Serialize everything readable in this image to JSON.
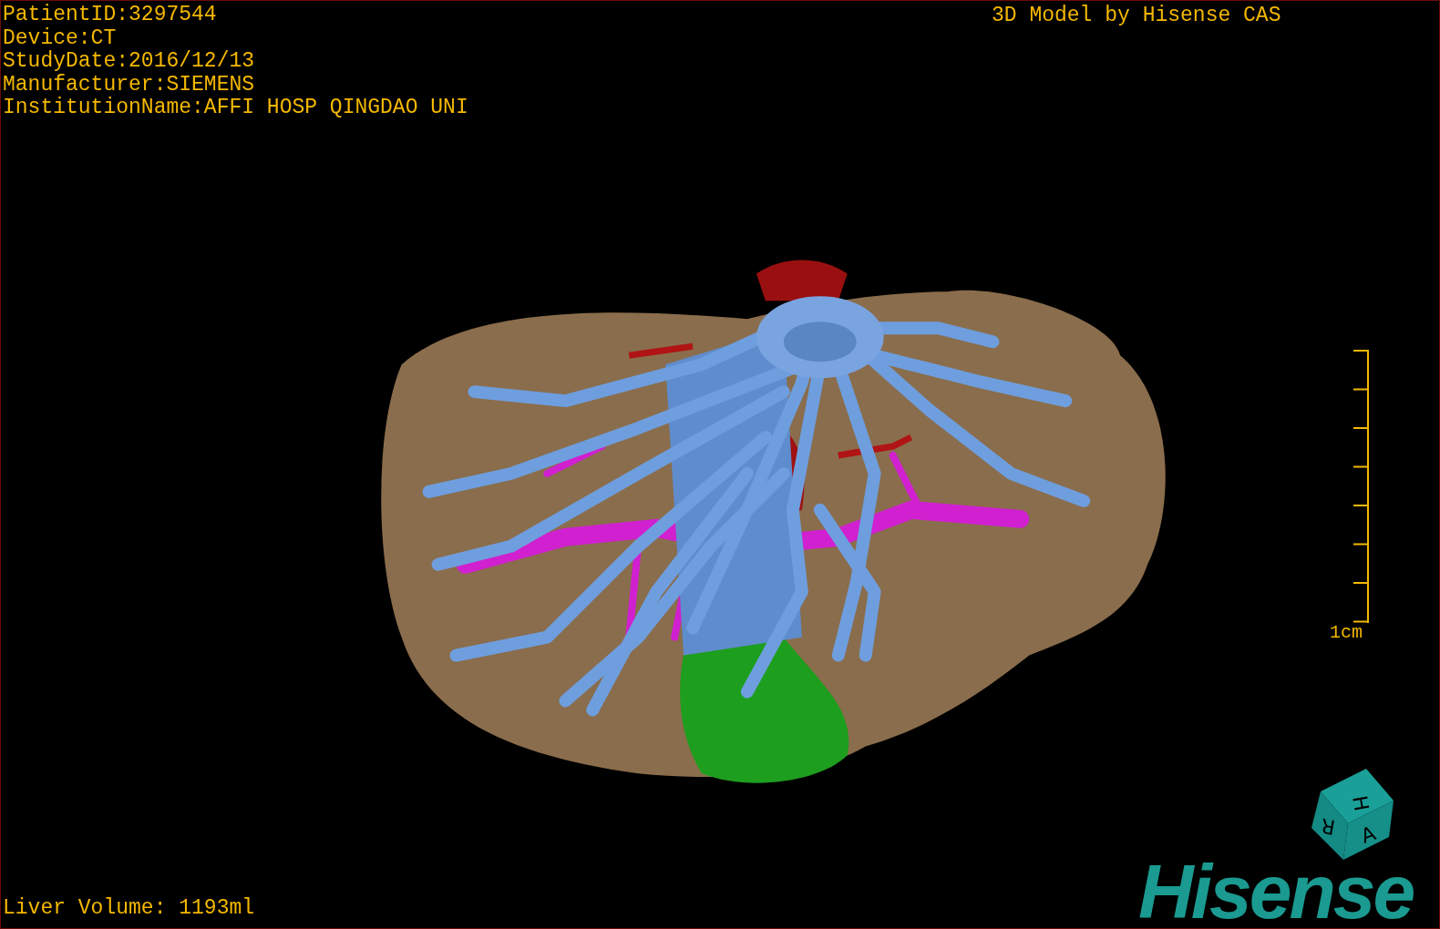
{
  "patient_info": [
    "PatientID:3297544",
    "Device:CT",
    "StudyDate:2016/12/13",
    "Manufacturer:SIEMENS",
    "InstitutionName:AFFI HOSP QINGDAO UNI"
  ],
  "header": "3D Model by Hisense CAS",
  "scale_bar": {
    "label": "1cm"
  },
  "orientation_cube": {
    "faces": [
      "H",
      "R",
      "A"
    ]
  },
  "logo": "Hisense",
  "liver_volume": "Liver Volume: 1193ml"
}
